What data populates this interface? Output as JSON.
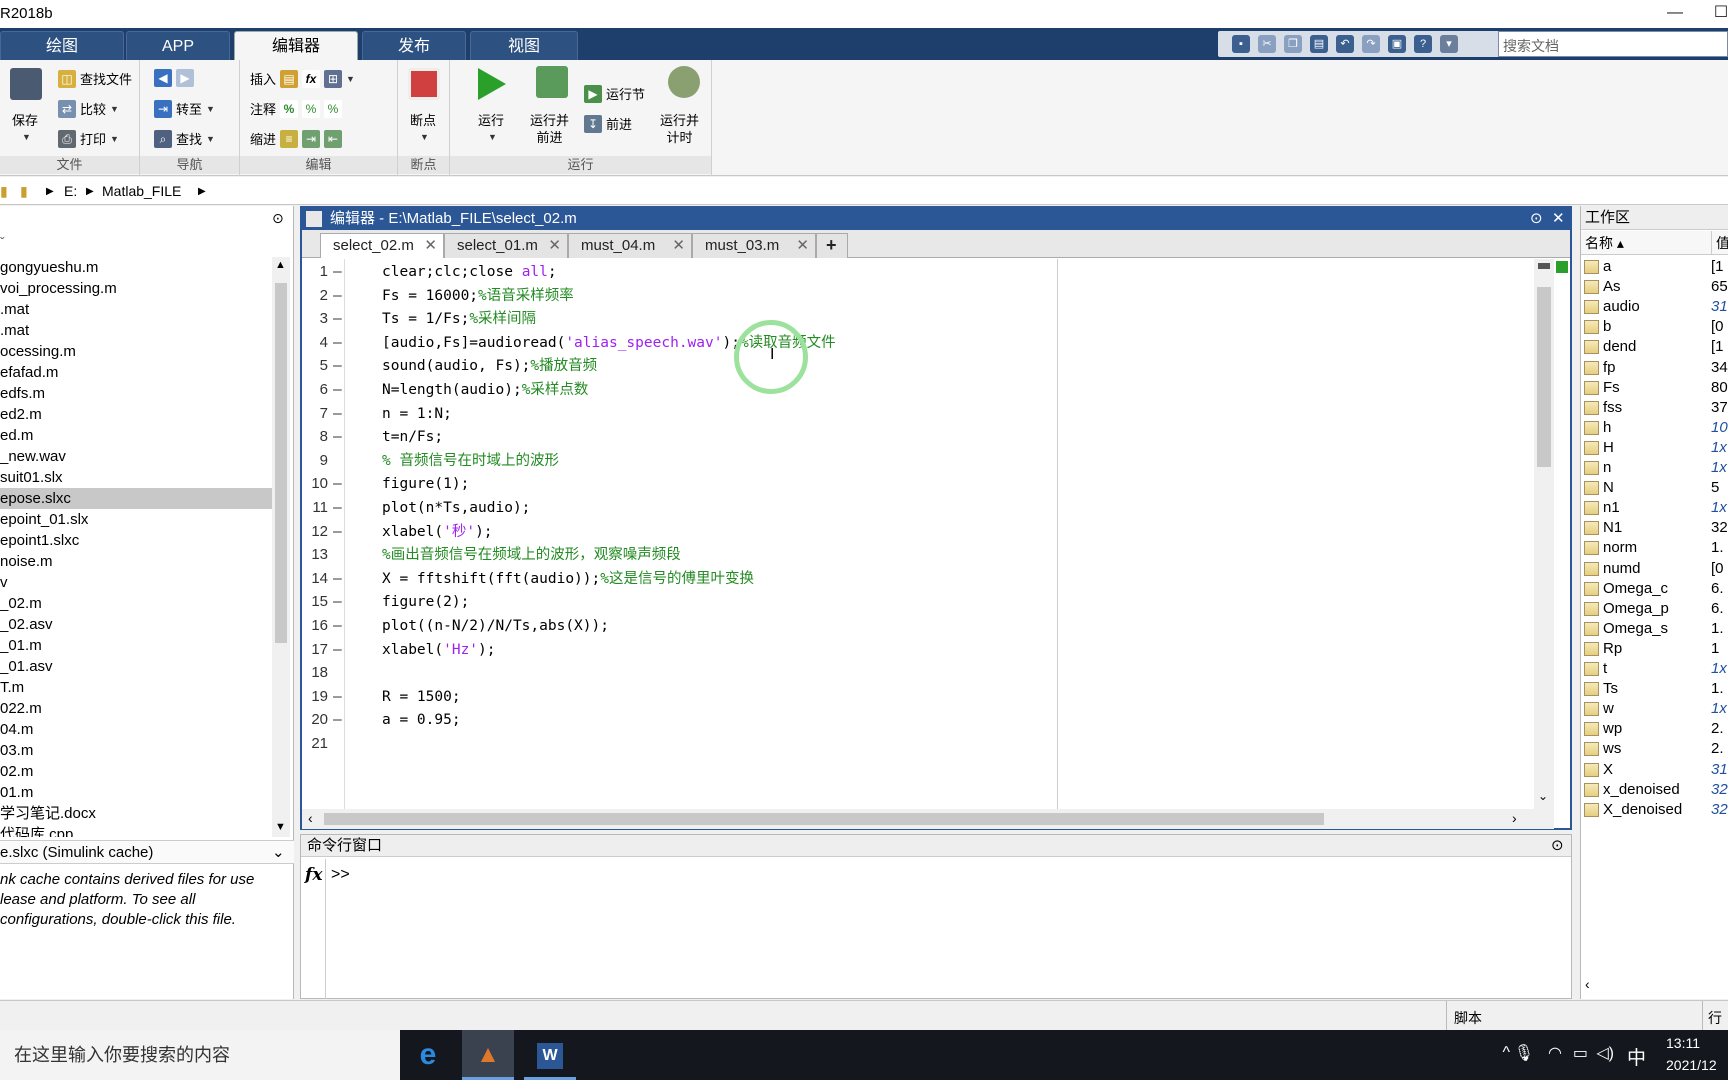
{
  "window": {
    "title": "R2018b",
    "minimize": "—",
    "maximize": "☐"
  },
  "ribbon_tabs": [
    {
      "label": "绘图"
    },
    {
      "label": "APP"
    },
    {
      "label": "编辑器"
    },
    {
      "label": "发布"
    },
    {
      "label": "视图"
    }
  ],
  "search_docs_placeholder": "搜索文档",
  "ribbon": {
    "file": {
      "group": "文件",
      "save": "保存",
      "find_file": "查找文件",
      "compare": "比较",
      "print": "打印"
    },
    "nav": {
      "group": "导航",
      "goto": "转至",
      "find": "查找"
    },
    "edit": {
      "group": "编辑",
      "insert": "插入",
      "comment": "注释",
      "indent": "缩进"
    },
    "breakpoints": {
      "group": "断点",
      "label": "断点"
    },
    "run": {
      "group": "运行",
      "run": "运行",
      "run_advance_1": "运行并",
      "run_advance_2": "前进",
      "run_section": "运行节",
      "advance": "前进",
      "run_time_1": "运行并",
      "run_time_2": "计时"
    }
  },
  "address": {
    "drive": "E:",
    "folder": "Matlab_FILE"
  },
  "files": [
    "gongyueshu.m",
    "voi_processing.m",
    ".mat",
    ".mat",
    "ocessing.m",
    "efafad.m",
    "edfs.m",
    "ed2.m",
    "ed.m",
    "_new.wav",
    "suit01.slx",
    "epose.slxc",
    "epoint_01.slx",
    "epoint1.slxc",
    "noise.m",
    "v",
    "_02.m",
    "_02.asv",
    "_01.m",
    "_01.asv",
    "T.m",
    "022.m",
    "04.m",
    "03.m",
    "02.m",
    "01.m",
    "学习笔记.docx",
    "代码库.cpp"
  ],
  "selected_file_index": 11,
  "details": {
    "header": "e.slxc  (Simulink cache)",
    "text": "nk cache contains derived files for use lease and platform. To see all configurations, double-click this file."
  },
  "editor": {
    "title": "编辑器 - E:\\Matlab_FILE\\select_02.m",
    "tabs": [
      {
        "label": "select_02.m"
      },
      {
        "label": "select_01.m"
      },
      {
        "label": "must_04.m"
      },
      {
        "label": "must_03.m"
      }
    ],
    "add_tab": "+",
    "lines": [
      {
        "num": "1",
        "dash": "—",
        "parts": [
          {
            "t": "clear;clc;close ",
            "c": ""
          },
          {
            "t": "all",
            "c": "st"
          },
          {
            "t": ";",
            "c": ""
          }
        ]
      },
      {
        "num": "2",
        "dash": "—",
        "parts": [
          {
            "t": "Fs = 16000;",
            "c": ""
          },
          {
            "t": "%语音采样频率",
            "c": "cm"
          }
        ]
      },
      {
        "num": "3",
        "dash": "—",
        "parts": [
          {
            "t": "Ts = 1/Fs;",
            "c": ""
          },
          {
            "t": "%采样间隔",
            "c": "cm"
          }
        ]
      },
      {
        "num": "4",
        "dash": "—",
        "parts": [
          {
            "t": "[audio,Fs]=audioread(",
            "c": ""
          },
          {
            "t": "'alias_speech.wav'",
            "c": "st"
          },
          {
            "t": ");",
            "c": ""
          },
          {
            "t": "%读取音频文件",
            "c": "cm"
          }
        ]
      },
      {
        "num": "5",
        "dash": "—",
        "parts": [
          {
            "t": "sound(audio, Fs);",
            "c": ""
          },
          {
            "t": "%播放音频",
            "c": "cm"
          }
        ]
      },
      {
        "num": "6",
        "dash": "—",
        "parts": [
          {
            "t": "N=length(audio);",
            "c": ""
          },
          {
            "t": "%采样点数",
            "c": "cm"
          }
        ]
      },
      {
        "num": "7",
        "dash": "—",
        "parts": [
          {
            "t": "n = 1:N;",
            "c": ""
          }
        ]
      },
      {
        "num": "8",
        "dash": "—",
        "parts": [
          {
            "t": "t=n/Fs;",
            "c": ""
          }
        ]
      },
      {
        "num": "9",
        "dash": "",
        "parts": [
          {
            "t": "% 音频信号在时域上的波形",
            "c": "cm"
          }
        ]
      },
      {
        "num": "10",
        "dash": "—",
        "parts": [
          {
            "t": "figure(1);",
            "c": ""
          }
        ]
      },
      {
        "num": "11",
        "dash": "—",
        "parts": [
          {
            "t": "plot(n*Ts,audio);",
            "c": ""
          }
        ]
      },
      {
        "num": "12",
        "dash": "—",
        "parts": [
          {
            "t": "xlabel(",
            "c": ""
          },
          {
            "t": "'秒'",
            "c": "st"
          },
          {
            "t": ");",
            "c": ""
          }
        ]
      },
      {
        "num": "13",
        "dash": "",
        "parts": [
          {
            "t": "%画出音频信号在频域上的波形，观察噪声频段",
            "c": "cm"
          }
        ]
      },
      {
        "num": "14",
        "dash": "—",
        "parts": [
          {
            "t": "X = fftshift(fft(audio));",
            "c": ""
          },
          {
            "t": "%这是信号的傅里叶变换",
            "c": "cm"
          }
        ]
      },
      {
        "num": "15",
        "dash": "—",
        "parts": [
          {
            "t": "figure(2);",
            "c": ""
          }
        ]
      },
      {
        "num": "16",
        "dash": "—",
        "parts": [
          {
            "t": "plot((n-N/2)/N/Ts,abs(X));",
            "c": ""
          }
        ]
      },
      {
        "num": "17",
        "dash": "—",
        "parts": [
          {
            "t": "xlabel(",
            "c": ""
          },
          {
            "t": "'Hz'",
            "c": "st"
          },
          {
            "t": ");",
            "c": ""
          }
        ]
      },
      {
        "num": "18",
        "dash": "",
        "parts": []
      },
      {
        "num": "19",
        "dash": "—",
        "parts": [
          {
            "t": "R = 1500;",
            "c": ""
          }
        ]
      },
      {
        "num": "20",
        "dash": "—",
        "parts": [
          {
            "t": "a = 0.95;",
            "c": ""
          }
        ]
      },
      {
        "num": "21",
        "dash": "",
        "parts": []
      }
    ]
  },
  "command_window": {
    "title": "命令行窗口",
    "fx": "fx",
    "prompt": ">>"
  },
  "workspace": {
    "title": "工作区",
    "col_name": "名称 ▴",
    "col_value": "值",
    "vars": [
      {
        "name": "a",
        "value": "[1",
        "italic": false
      },
      {
        "name": "As",
        "value": "65",
        "italic": false
      },
      {
        "name": "audio",
        "value": "31",
        "italic": true
      },
      {
        "name": "b",
        "value": "[0",
        "italic": false
      },
      {
        "name": "dend",
        "value": "[1",
        "italic": false
      },
      {
        "name": "fp",
        "value": "34",
        "italic": false
      },
      {
        "name": "Fs",
        "value": "80",
        "italic": false
      },
      {
        "name": "fss",
        "value": "37",
        "italic": false
      },
      {
        "name": "h",
        "value": "10",
        "italic": true
      },
      {
        "name": "H",
        "value": "1x",
        "italic": true
      },
      {
        "name": "n",
        "value": "1x",
        "italic": true
      },
      {
        "name": "N",
        "value": "5",
        "italic": false
      },
      {
        "name": "n1",
        "value": "1x",
        "italic": true
      },
      {
        "name": "N1",
        "value": "32",
        "italic": false
      },
      {
        "name": "norm",
        "value": "1.",
        "italic": false
      },
      {
        "name": "numd",
        "value": "[0",
        "italic": false
      },
      {
        "name": "Omega_c",
        "value": "6.",
        "italic": false
      },
      {
        "name": "Omega_p",
        "value": "6.",
        "italic": false
      },
      {
        "name": "Omega_s",
        "value": "1.",
        "italic": false
      },
      {
        "name": "Rp",
        "value": "1",
        "italic": false
      },
      {
        "name": "t",
        "value": "1x",
        "italic": true
      },
      {
        "name": "Ts",
        "value": "1.",
        "italic": false
      },
      {
        "name": "w",
        "value": "1x",
        "italic": true
      },
      {
        "name": "wp",
        "value": "2.",
        "italic": false
      },
      {
        "name": "ws",
        "value": "2.",
        "italic": false
      },
      {
        "name": "X",
        "value": "31",
        "italic": true
      },
      {
        "name": "x_denoised",
        "value": "32",
        "italic": true
      },
      {
        "name": "X_denoised",
        "value": "32",
        "italic": true
      }
    ]
  },
  "status": {
    "type": "脚本",
    "line": "行"
  },
  "taskbar": {
    "search_placeholder": "在这里输入你要搜索的内容",
    "ime": "中",
    "time": "13:11",
    "date": "2021/12"
  },
  "colors": {
    "accent": "#2b5797",
    "comment": "#228b22",
    "string": "#a020f0",
    "taskbar": "#14181e"
  }
}
